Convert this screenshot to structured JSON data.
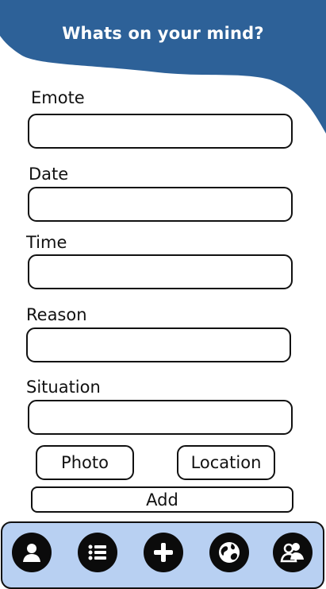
{
  "header": {
    "title": "Whats on your mind?",
    "color": "#2d6198"
  },
  "form": {
    "emote_label": "Emote",
    "date_label": "Date",
    "time_label": "Time",
    "reason_label": "Reason",
    "situation_label": "Situation",
    "emote_value": "",
    "date_value": "",
    "time_value": "",
    "reason_value": "",
    "situation_value": ""
  },
  "buttons": {
    "photo": "Photo",
    "location": "Location",
    "add": "Add"
  },
  "bottom_nav": {
    "background": "#b8d0f2",
    "items": [
      "profile-icon",
      "list-icon",
      "add-icon",
      "globe-icon",
      "group-icon"
    ]
  }
}
